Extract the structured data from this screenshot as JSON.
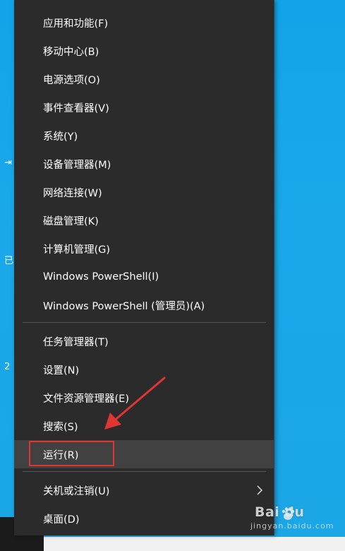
{
  "desktop": {
    "edge_glyphs": [
      "⇥",
      "已",
      "2"
    ]
  },
  "menu": {
    "group1": [
      {
        "id": "apps-features",
        "label": "应用和功能(F)"
      },
      {
        "id": "mobility-center",
        "label": "移动中心(B)"
      },
      {
        "id": "power-options",
        "label": "电源选项(O)"
      },
      {
        "id": "event-viewer",
        "label": "事件查看器(V)"
      },
      {
        "id": "system",
        "label": "系统(Y)"
      },
      {
        "id": "device-manager",
        "label": "设备管理器(M)"
      },
      {
        "id": "network-connections",
        "label": "网络连接(W)"
      },
      {
        "id": "disk-management",
        "label": "磁盘管理(K)"
      },
      {
        "id": "computer-management",
        "label": "计算机管理(G)"
      },
      {
        "id": "powershell",
        "label": "Windows PowerShell(I)"
      },
      {
        "id": "powershell-admin",
        "label": "Windows PowerShell (管理员)(A)"
      }
    ],
    "group2": [
      {
        "id": "task-manager",
        "label": "任务管理器(T)"
      },
      {
        "id": "settings",
        "label": "设置(N)"
      },
      {
        "id": "file-explorer",
        "label": "文件资源管理器(E)"
      },
      {
        "id": "search",
        "label": "搜索(S)"
      },
      {
        "id": "run",
        "label": "运行(R)",
        "highlighted": true
      }
    ],
    "group3": [
      {
        "id": "shutdown-signout",
        "label": "关机或注销(U)",
        "has_submenu": true
      },
      {
        "id": "desktop",
        "label": "桌面(D)"
      }
    ]
  },
  "annotation": {
    "highlight_color": "#e03535",
    "target": "运行(R)"
  },
  "watermark": {
    "main": "Bai du",
    "sub": "jingyan.baidu.com"
  },
  "colors": {
    "menu_bg": "#2b2b2b",
    "menu_text": "#ffffff",
    "hover_bg": "#414141",
    "desktop_bg": "#1aa8ea"
  }
}
